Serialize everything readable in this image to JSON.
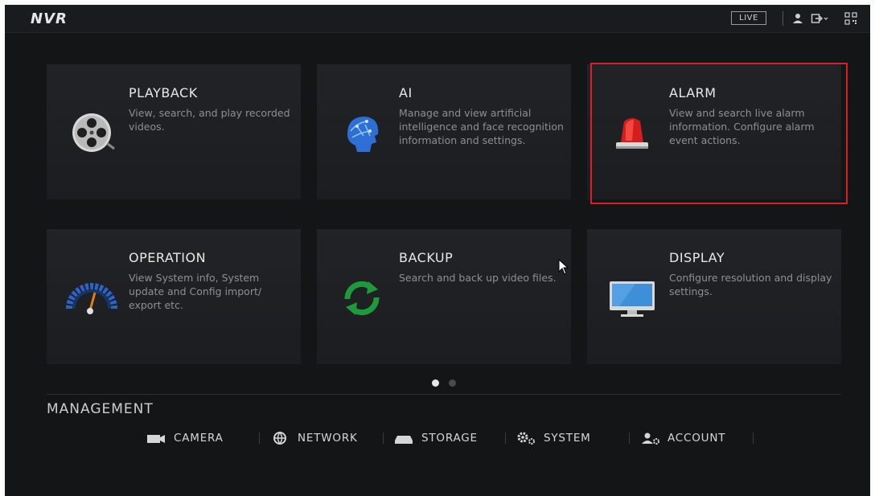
{
  "header": {
    "logo": "NVR",
    "live_label": "LIVE",
    "icons": [
      "user-icon",
      "logout-icon",
      "qr-code-icon"
    ]
  },
  "tiles": [
    {
      "title": "PLAYBACK",
      "description": "View, search, and play recorded videos.",
      "icon": "film-reel-icon"
    },
    {
      "title": "AI",
      "description": "Manage and view artificial intelligence and face recognition information and settings.",
      "icon": "ai-head-icon"
    },
    {
      "title": "ALARM",
      "description": "View and search live alarm information. Configure alarm event actions.",
      "icon": "alarm-light-icon"
    },
    {
      "title": "OPERATION",
      "description": "View System info, System update and Config import/ export etc.",
      "icon": "speedometer-icon"
    },
    {
      "title": "BACKUP",
      "description": "Search and back up video files.",
      "icon": "refresh-arrows-icon"
    },
    {
      "title": "DISPLAY",
      "description": "Configure resolution and display settings.",
      "icon": "monitor-icon"
    }
  ],
  "pagination": {
    "current": 1,
    "total": 2
  },
  "management": {
    "title": "MANAGEMENT",
    "items": [
      {
        "label": "CAMERA",
        "icon": "camera-icon"
      },
      {
        "label": "NETWORK",
        "icon": "network-globe-icon"
      },
      {
        "label": "STORAGE",
        "icon": "storage-drive-icon"
      },
      {
        "label": "SYSTEM",
        "icon": "gears-icon"
      },
      {
        "label": "ACCOUNT",
        "icon": "account-gear-icon"
      }
    ]
  },
  "colors": {
    "background": "#141517",
    "tile": "#1f2023",
    "highlight": "#d9202a",
    "text": "#e8e8e8",
    "muted": "#8e8f93"
  }
}
